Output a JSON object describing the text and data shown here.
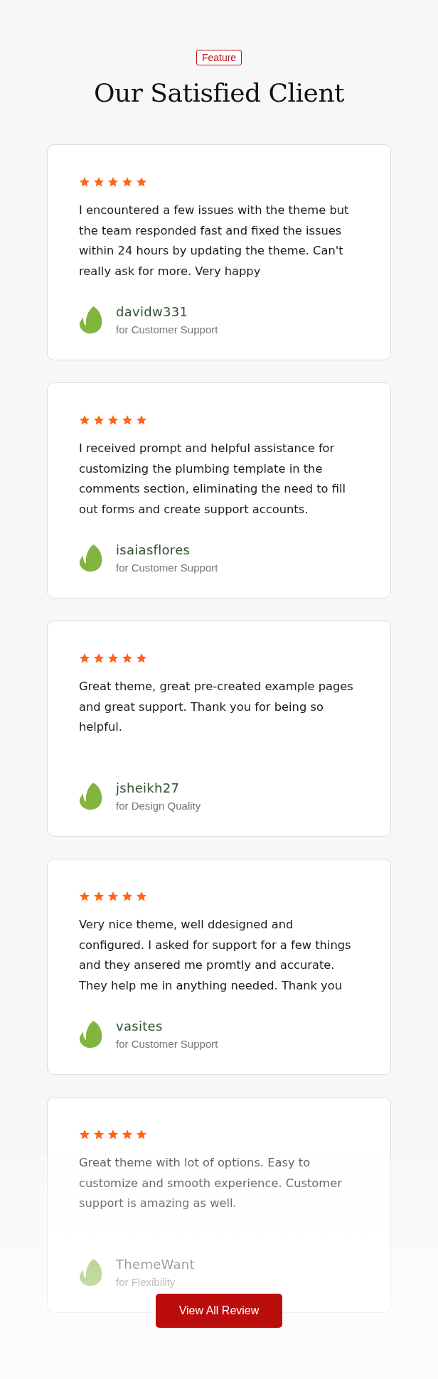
{
  "badge": "Feature",
  "title": "Our Satisfied Client",
  "reviews": [
    {
      "stars": 5,
      "text": "I encountered a few issues with the theme but the team responded fast and fixed the issues within 24 hours by updating the theme. Can't really ask for more. Very happy",
      "author": "davidw331",
      "category": "for Customer Support"
    },
    {
      "stars": 5,
      "text": "I received prompt and helpful assistance for customizing the plumbing template in the comments section, eliminating the need to fill out forms and create support accounts.",
      "author": "isaiasflores",
      "category": "for Customer Support"
    },
    {
      "stars": 5,
      "text": "Great theme, great pre-created example pages and great support. Thank you for being so helpful.",
      "author": "jsheikh27",
      "category": "for Design Quality"
    },
    {
      "stars": 5,
      "text": "Very nice theme, well ddesigned and configured. I asked for support for a few things and they ansered me promtly and accurate. They help me in anything needed. Thank you",
      "author": "vasites",
      "category": "for Customer Support"
    },
    {
      "stars": 5,
      "text": "Great theme with lot of options. Easy to customize and smooth experience. Customer support is amazing as well.",
      "author": "ThemeWant",
      "category": "for Flexibility"
    }
  ],
  "button": "View All Review"
}
